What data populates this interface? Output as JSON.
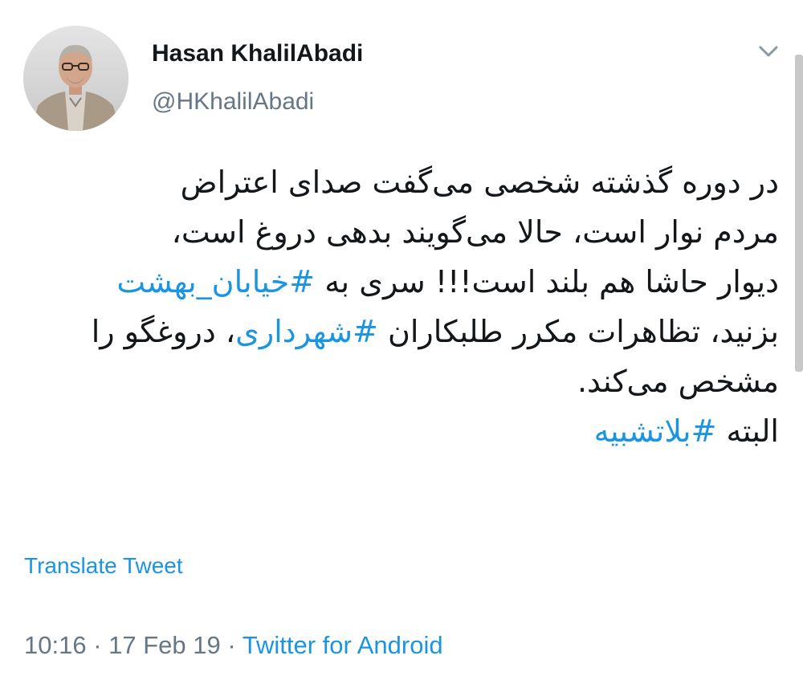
{
  "author": {
    "display_name": "Hasan KhalilAbadi",
    "handle": "@HKhalilAbadi",
    "avatar_icon": "profile-photo"
  },
  "menu": {
    "icon": "chevron-down-icon"
  },
  "tweet": {
    "lines": [
      [
        {
          "text": "در دوره گذشته شخصی می‌گفت صدای اعتراض",
          "hashtag": false
        }
      ],
      [
        {
          "text": "مردم نوار است، حالا می‌گویند بدهی دروغ است،",
          "hashtag": false
        }
      ],
      [
        {
          "text": "دیوار حاشا هم بلند است!!! سری به ",
          "hashtag": false
        },
        {
          "text": "#خیابان_بهشت",
          "hashtag": true
        }
      ],
      [
        {
          "text": "بزنید، تظاهرات مکرر طلبکاران ",
          "hashtag": false
        },
        {
          "text": "#شهرداری",
          "hashtag": true
        },
        {
          "text": "، دروغگو را",
          "hashtag": false
        }
      ],
      [
        {
          "text": "مشخص می‌کند.",
          "hashtag": false
        }
      ],
      [
        {
          "text": "البته ",
          "hashtag": false
        },
        {
          "text": "#بلاتشبیه",
          "hashtag": true
        }
      ]
    ]
  },
  "translate_label": "Translate Tweet",
  "meta": {
    "time": "10:16",
    "separator": " · ",
    "date": "17 Feb 19",
    "source": "Twitter for Android"
  },
  "colors": {
    "link": "#1b95e0",
    "text": "#14171a",
    "secondary": "#657786"
  }
}
